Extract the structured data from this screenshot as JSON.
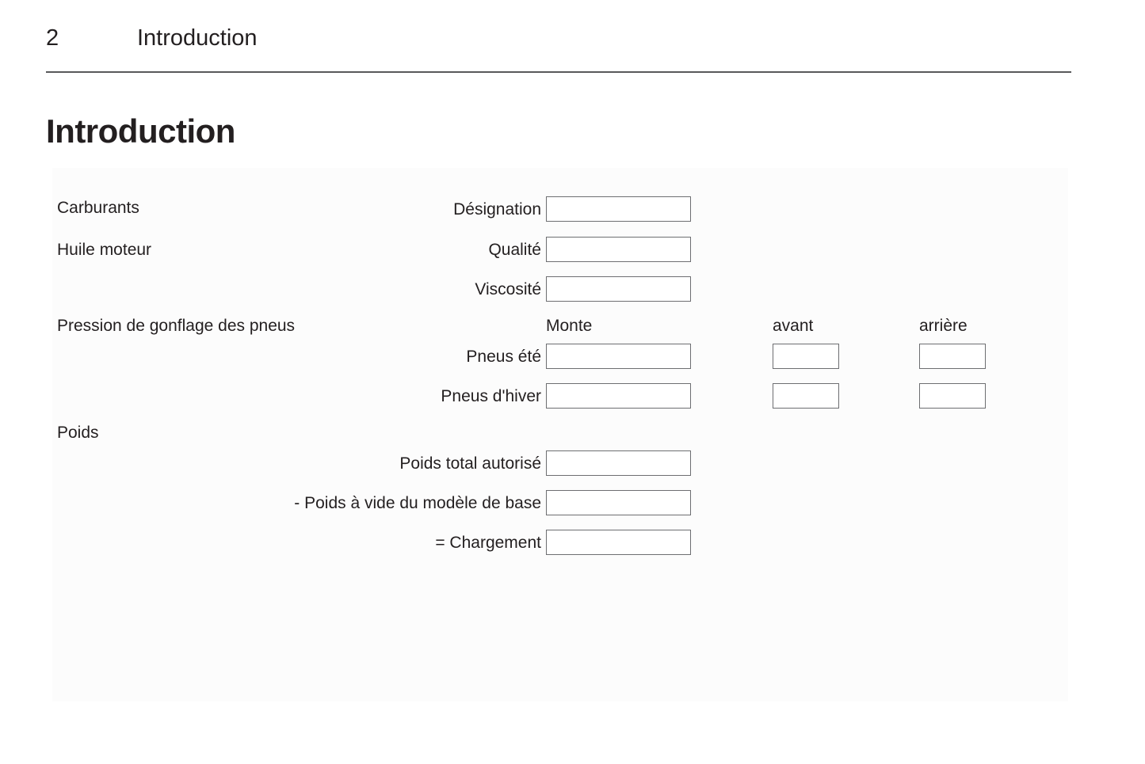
{
  "header": {
    "page_number": "2",
    "chapter": "Introduction"
  },
  "title": "Introduction",
  "sections": [
    {
      "label": "Carburants"
    },
    {
      "label": "Huile moteur"
    },
    {
      "label": "Pression de gonflage des pneus"
    },
    {
      "label": "Poids"
    }
  ],
  "columns": {
    "monte": "Monte",
    "avant": "avant",
    "arriere": "arrière"
  },
  "fields": [
    {
      "label": "Désignation",
      "value": ""
    },
    {
      "label": "Qualité",
      "value": ""
    },
    {
      "label": "Viscosité",
      "value": ""
    },
    {
      "label": "Pneus été",
      "value": "",
      "avant": "",
      "arriere": ""
    },
    {
      "label": "Pneus d'hiver",
      "value": "",
      "avant": "",
      "arriere": ""
    },
    {
      "label": "Poids total autorisé",
      "value": ""
    },
    {
      "label": "- Poids à vide du modèle de base",
      "value": ""
    },
    {
      "label": "= Chargement",
      "value": ""
    }
  ],
  "colors": {
    "text": "#231f20",
    "rule": "#58595b",
    "box_border": "#6d6e71",
    "panel_bg": "#fcfcfc",
    "page_bg": "#ffffff"
  }
}
